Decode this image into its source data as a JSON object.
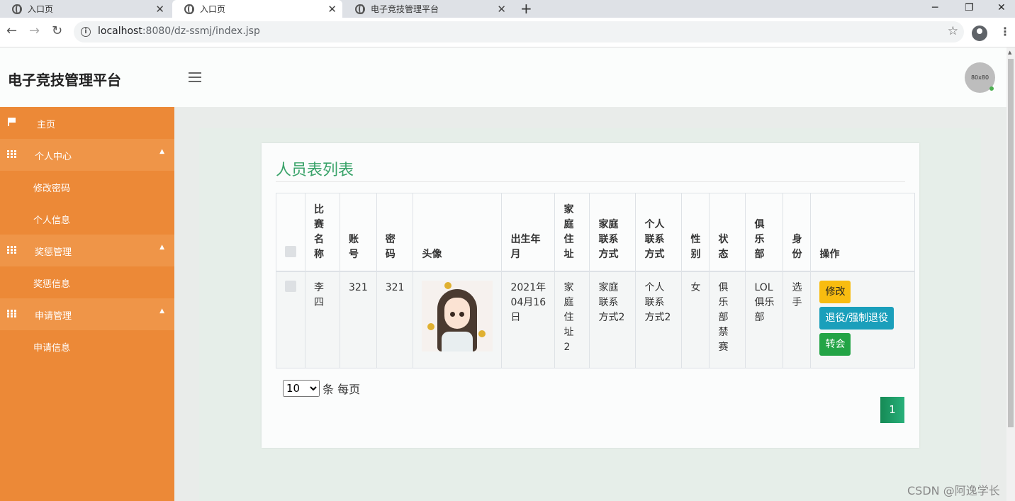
{
  "browser": {
    "tabs": [
      {
        "title": "入口页",
        "active": false
      },
      {
        "title": "入口页",
        "active": true
      },
      {
        "title": "电子竞技管理平台",
        "active": false
      }
    ],
    "url_host": "localhost",
    "url_path": ":8080/dz-ssmj/index.jsp"
  },
  "header": {
    "brand": "电子竞技管理平台",
    "avatar_text": "80x80"
  },
  "sidebar": {
    "items": [
      {
        "label": "主页",
        "icon": "flag-icon",
        "type": "link"
      },
      {
        "label": "个人中心",
        "icon": "grid-icon",
        "type": "group"
      },
      {
        "label": "修改密码",
        "type": "sub"
      },
      {
        "label": "个人信息",
        "type": "sub"
      },
      {
        "label": "奖惩管理",
        "icon": "grid-icon",
        "type": "group"
      },
      {
        "label": "奖惩信息",
        "type": "sub"
      },
      {
        "label": "申请管理",
        "icon": "grid-icon",
        "type": "group"
      },
      {
        "label": "申请信息",
        "type": "sub"
      }
    ]
  },
  "main": {
    "title": "人员表列表",
    "table": {
      "headers": [
        "比赛名称",
        "账号",
        "密码",
        "头像",
        "出生年月",
        "家庭住址",
        "家庭联系方式",
        "个人联系方式",
        "性别",
        "状态",
        "俱乐部",
        "身份",
        "操作"
      ],
      "rows": [
        {
          "name": "李四",
          "account": "321",
          "password": "321",
          "birth": "2021年04月16日",
          "address": "家庭住址2",
          "home_contact": "家庭联系方式2",
          "personal_contact": "个人联系方式2",
          "gender": "女",
          "status": "俱乐部禁赛",
          "club": "LOL俱乐部",
          "role": "选手"
        }
      ],
      "actions": [
        "修改",
        "退役/强制退役",
        "转会"
      ]
    },
    "page_size": "10",
    "page_size_suffix": "条 每页",
    "current_page": "1"
  },
  "watermark": "CSDN @阿逸学长",
  "colors": {
    "sidebar": "#ec8937",
    "sidebar_group": "#ef9548",
    "title_green": "#3aa36a",
    "btn_edit": "#f8bc10",
    "btn_retire": "#1a9fbb",
    "btn_transfer": "#23a446"
  }
}
